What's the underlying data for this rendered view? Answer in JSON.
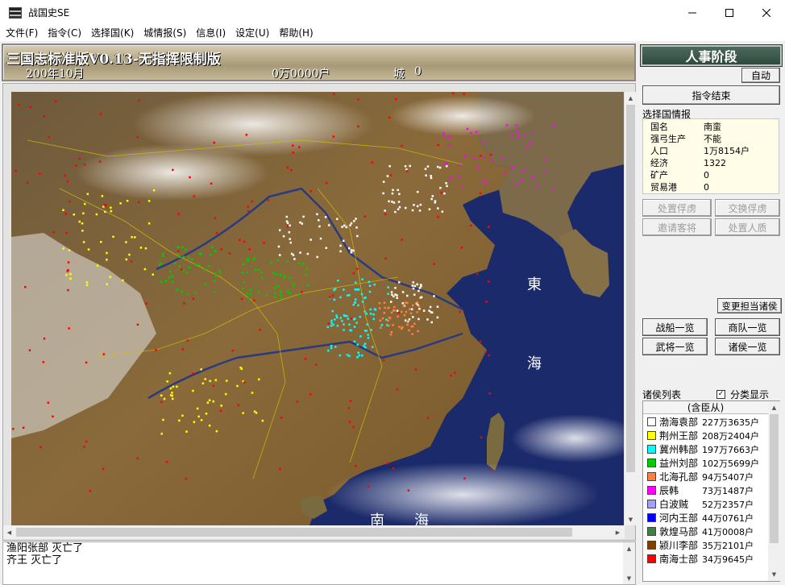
{
  "window": {
    "title": "战国史SE"
  },
  "menu": [
    "文件(F)",
    "指令(C)",
    "选择国(K)",
    "城情报(S)",
    "信息(I)",
    "设定(U)",
    "帮助(H)"
  ],
  "header": {
    "scenario": "三国志标准版V0.13-无指挥限制版",
    "date": "200年10月",
    "households": "0万0000户",
    "city_label": "城",
    "city_count": "0"
  },
  "map": {
    "labels": [
      "東",
      "海",
      "南",
      "海"
    ],
    "colors": {
      "sea": "#1b2a6a",
      "land": "#8a6a3a"
    }
  },
  "log": {
    "lines": [
      "渔阳张部 灭亡了",
      "齐王 灭亡了"
    ]
  },
  "right": {
    "phase": "人事阶段",
    "auto": "自动",
    "end_command": "指令结束",
    "info_header": "选择国情报",
    "info": [
      {
        "k": "国名",
        "v": "南蛮"
      },
      {
        "k": "强弓生产",
        "v": "不能"
      },
      {
        "k": "人口",
        "v": "1万8154户"
      },
      {
        "k": "经济",
        "v": "1322"
      },
      {
        "k": "矿产",
        "v": "0"
      },
      {
        "k": "贸易港",
        "v": "0"
      }
    ],
    "buttons": {
      "prisoners": "处置俘虏",
      "exchange": "交换俘虏",
      "invite": "邀请客将",
      "hostage": "处置人质",
      "change_lord": "变更担当诸侯",
      "ships": "战船一览",
      "caravan": "商队一览",
      "generals": "武将一览",
      "lords": "诸侯一览"
    },
    "lord_header": "诸侯列表",
    "classify": "分类显示",
    "list_col": "(含臣从)",
    "lords": [
      {
        "name": "渤海袁部",
        "pop": "227万3635户",
        "color": "#ffffff"
      },
      {
        "name": "荆州王部",
        "pop": "208万2404户",
        "color": "#ffff00"
      },
      {
        "name": "冀州韩部",
        "pop": "197万7663户",
        "color": "#00ffff"
      },
      {
        "name": "益州刘部",
        "pop": "102万5699户",
        "color": "#00cc00"
      },
      {
        "name": "北海孔部",
        "pop": "94万5407户",
        "color": "#ff8040"
      },
      {
        "name": "辰韩",
        "pop": "73万1487户",
        "color": "#ff00ff"
      },
      {
        "name": "白波贼",
        "pop": "52万2357户",
        "color": "#a0a0ff"
      },
      {
        "name": "河内王部",
        "pop": "44万0761户",
        "color": "#0000ff"
      },
      {
        "name": "敦煌马部",
        "pop": "41万0008户",
        "color": "#408040"
      },
      {
        "name": "颍川李部",
        "pop": "35万2101户",
        "color": "#804000"
      },
      {
        "name": "南海士部",
        "pop": "34万9645户",
        "color": "#ff0000"
      }
    ]
  }
}
